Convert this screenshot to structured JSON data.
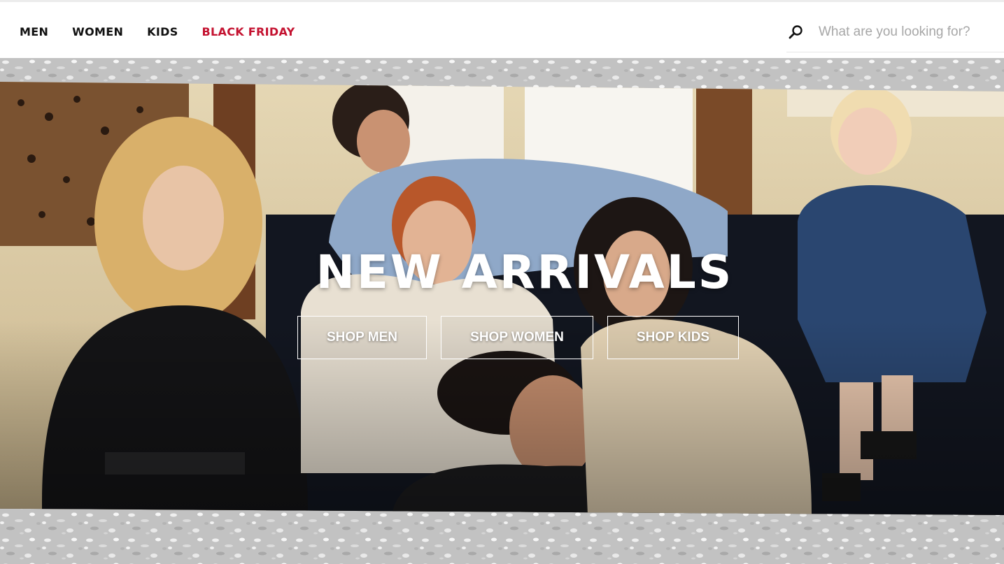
{
  "nav": {
    "items": [
      {
        "label": "MEN"
      },
      {
        "label": "WOMEN"
      },
      {
        "label": "KIDS"
      },
      {
        "label": "BLACK FRIDAY",
        "color": "#c41230"
      }
    ]
  },
  "search": {
    "placeholder": "What are you looking for?",
    "icon": "search-icon"
  },
  "hero": {
    "title": "NEW ARRIVALS",
    "buttons": [
      {
        "label": "SHOP MEN"
      },
      {
        "label": "SHOP WOMEN"
      },
      {
        "label": "SHOP KIDS"
      }
    ]
  },
  "colors": {
    "accent": "#c41230",
    "text": "#111111",
    "placeholder": "#a7a7a7"
  }
}
